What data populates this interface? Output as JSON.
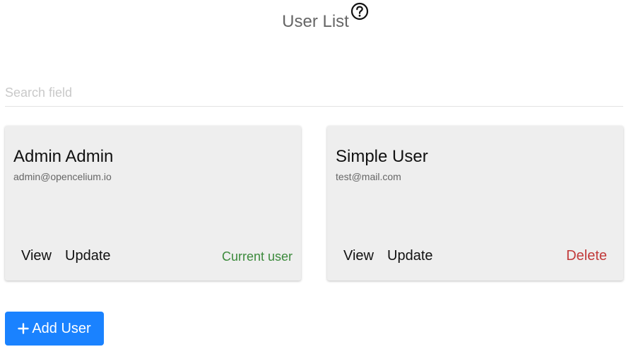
{
  "header": {
    "title": "User List",
    "help_icon": "question-circle-icon"
  },
  "search": {
    "placeholder": "Search field",
    "value": ""
  },
  "users": [
    {
      "name": "Admin Admin",
      "email": "admin@opencelium.io",
      "view_label": "View",
      "update_label": "Update",
      "status_label": "Current user"
    },
    {
      "name": "Simple User",
      "email": "test@mail.com",
      "view_label": "View",
      "update_label": "Update",
      "delete_label": "Delete"
    }
  ],
  "actions": {
    "add_user_label": "Add User",
    "add_icon": "plus-icon"
  },
  "colors": {
    "primary": "#1a82ff",
    "current_user": "#3c8a3c",
    "delete": "#c23a3a",
    "card_background": "#eeeeee"
  }
}
